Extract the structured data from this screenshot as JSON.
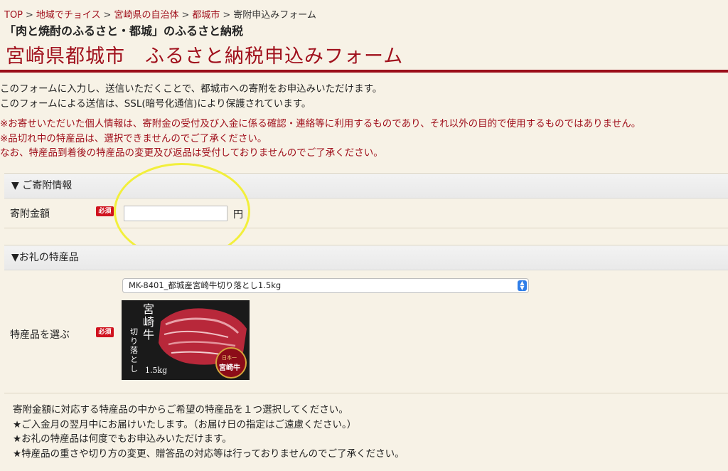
{
  "breadcrumb": {
    "items": [
      "TOP",
      "地域でチョイス",
      "宮崎県の自治体",
      "都城市"
    ],
    "current": "寄附申込みフォーム",
    "separator": ">"
  },
  "subtitle": "「肉と焼酎のふるさと・都城」のふるさと納税",
  "page_title": "宮崎県都城市　ふるさと納税申込みフォーム",
  "intro": {
    "lines": [
      "このフォームに入力し、送信いただくことで、都城市への寄附をお申込みいただけます。",
      "このフォームによる送信は、SSL(暗号化通信)により保護されています。"
    ],
    "red_lines": [
      "※お寄せいただいた個人情報は、寄附金の受付及び入金に係る確認・連絡等に利用するものであり、それ以外の目的で使用するものではありません。",
      "※品切れ中の特産品は、選択できませんのでご了承ください。",
      "なお、特産品到着後の特産品の変更及び返品は受付しておりませんのでご了承ください。"
    ]
  },
  "donation_section": {
    "header": "▼ ご寄附情報",
    "amount_label": "寄附金額",
    "required_badge": "必須",
    "amount_value": "",
    "amount_placeholder": "",
    "unit": "円"
  },
  "gift_section": {
    "header": "▼お礼の特産品",
    "select_label": "特産品を選ぶ",
    "required_badge": "必須",
    "selected_option": "MK-8401_都城産宮崎牛切り落とし1.5kg",
    "image_text": {
      "title": "宮崎牛",
      "sub": "切り落とし",
      "weight": "1.5kg",
      "seal_top": "日本一",
      "seal_main": "宮崎牛"
    },
    "notes": [
      "寄附金額に対応する特産品の中からご希望の特産品を１つ選択してください。",
      "★ご入金月の翌月中にお届けいたします。（お届け日の指定はご遠慮ください。）",
      "★お礼の特産品は何度でもお申込みいただけます。",
      "★特産品の重さや切り方の変更、贈答品の対応等は行っておりませんのでご了承ください。"
    ]
  },
  "colors": {
    "accent": "#a0101c",
    "required": "#d0121e",
    "background": "#f7f2e6",
    "highlight": "#f2ef3c",
    "select_arrow": "#2f7ee8"
  }
}
